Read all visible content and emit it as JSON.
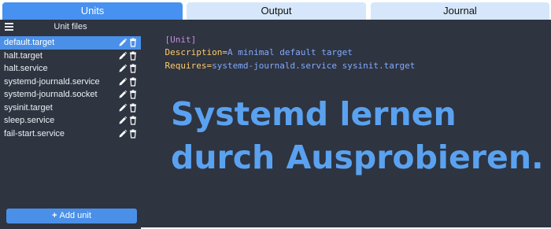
{
  "tabs": [
    {
      "label": "Units",
      "active": true
    },
    {
      "label": "Output",
      "active": false
    },
    {
      "label": "Journal",
      "active": false
    }
  ],
  "sidebar": {
    "menu_icon": "hamburger-icon",
    "title": "Unit files",
    "items": [
      {
        "name": "default.target",
        "selected": true
      },
      {
        "name": "halt.target",
        "selected": false
      },
      {
        "name": "halt.service",
        "selected": false
      },
      {
        "name": "systemd-journald.service",
        "selected": false
      },
      {
        "name": "systemd-journald.socket",
        "selected": false
      },
      {
        "name": "sysinit.target",
        "selected": false
      },
      {
        "name": "sleep.service",
        "selected": false
      },
      {
        "name": "fail-start.service",
        "selected": false
      }
    ],
    "item_icons": [
      "pencil-icon",
      "trash-icon"
    ],
    "add_button": {
      "icon": "+",
      "label": "Add unit"
    }
  },
  "editor": {
    "lines": [
      {
        "section": "[Unit]"
      },
      {
        "key": "Description",
        "eq": "=",
        "value": "A minimal default target"
      },
      {
        "key": "Requires",
        "eq": "=",
        "value": "systemd-journald.service sysinit.target"
      }
    ]
  },
  "overlay": {
    "line1": "Systemd lernen",
    "line2": "durch Ausprobieren."
  },
  "colors": {
    "accent": "#4a90e8",
    "tab_inactive": "#d6e7fb",
    "panel_bg": "#2e3440",
    "section": "#c48ee0",
    "key": "#ffcb6b",
    "value": "#82aaff",
    "overlay_text": "#5aa2f0"
  }
}
